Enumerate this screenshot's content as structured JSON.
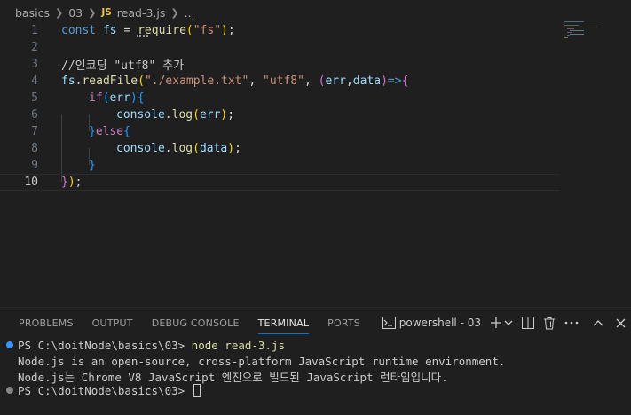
{
  "breadcrumb": {
    "items": [
      "basics",
      "03"
    ],
    "file_badge": "JS",
    "file_name": "read-3.js",
    "ellipsis": "..."
  },
  "editor": {
    "line_numbers": [
      "1",
      "2",
      "3",
      "4",
      "5",
      "6",
      "7",
      "8",
      "9",
      "10"
    ],
    "active_line": "10",
    "tokens": {
      "const": "const",
      "fs": "fs",
      "eq": " = ",
      "require": "require",
      "lparen": "(",
      "str_fs": "\"fs\"",
      "rparen_semi": ");",
      "comment": "//인코딩 \"utf8\" 추가",
      "readFile": "readFile",
      "dot": ".",
      "str_path": "\"./example.txt\"",
      "comma": ", ",
      "str_utf8": "\"utf8\"",
      "err": "err",
      "comma2": ",",
      "data": "data",
      "arrow": "=>",
      "lbrace": "{",
      "rbrace": "}",
      "if": "if",
      "else": "else",
      "console": "console",
      "log": "log",
      "semi": ";",
      "rbrace_paren_semi": "});"
    }
  },
  "panel": {
    "tabs": [
      "PROBLEMS",
      "OUTPUT",
      "DEBUG CONSOLE",
      "TERMINAL",
      "PORTS"
    ],
    "active_tab": "TERMINAL",
    "terminal_name": "powershell - 03"
  },
  "terminal": {
    "prompt1": "PS C:\\doitNode\\basics\\03> ",
    "command": "node read-3.js",
    "output1": "Node.js is an open-source, cross-platform JavaScript runtime environment.",
    "output2": "Node.js는 Chrome V8 JavaScript 엔진으로 빌드된 JavaScript 런타임입니다.",
    "prompt2": "PS C:\\doitNode\\basics\\03> "
  },
  "colors": {
    "background": "#1f1f1f",
    "keyword": "#569cd6",
    "variable": "#9cdcfe",
    "function": "#dcdcaa",
    "string": "#ce9178",
    "comment": "#6a9955",
    "accent": "#0078d4"
  },
  "icons": [
    "chevron-right-icon",
    "js-file-icon",
    "terminal-icon",
    "plus-icon",
    "chevron-down-icon",
    "split-icon",
    "trash-icon",
    "more-icon",
    "maximize-icon",
    "close-icon"
  ]
}
